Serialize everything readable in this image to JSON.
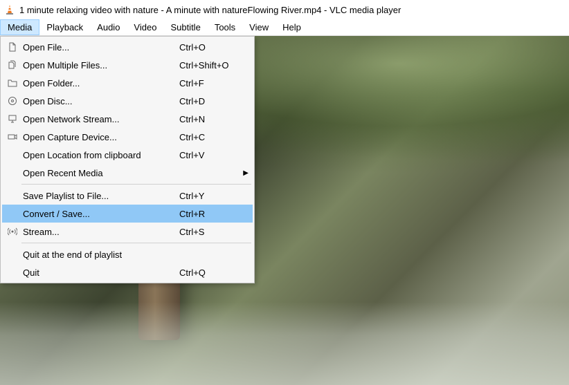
{
  "titlebar": {
    "title": "1 minute relaxing video with nature - A minute with natureFlowing River.mp4 - VLC media player"
  },
  "menubar": {
    "items": [
      {
        "label": "Media",
        "active": true
      },
      {
        "label": "Playback",
        "active": false
      },
      {
        "label": "Audio",
        "active": false
      },
      {
        "label": "Video",
        "active": false
      },
      {
        "label": "Subtitle",
        "active": false
      },
      {
        "label": "Tools",
        "active": false
      },
      {
        "label": "View",
        "active": false
      },
      {
        "label": "Help",
        "active": false
      }
    ]
  },
  "dropdown": {
    "items": [
      {
        "type": "item",
        "icon": "file-icon",
        "label": "Open File...",
        "shortcut": "Ctrl+O",
        "highlighted": false,
        "submenu": false,
        "name": "menu-open-file"
      },
      {
        "type": "item",
        "icon": "files-icon",
        "label": "Open Multiple Files...",
        "shortcut": "Ctrl+Shift+O",
        "highlighted": false,
        "submenu": false,
        "name": "menu-open-multiple-files"
      },
      {
        "type": "item",
        "icon": "folder-icon",
        "label": "Open Folder...",
        "shortcut": "Ctrl+F",
        "highlighted": false,
        "submenu": false,
        "name": "menu-open-folder"
      },
      {
        "type": "item",
        "icon": "disc-icon",
        "label": "Open Disc...",
        "shortcut": "Ctrl+D",
        "highlighted": false,
        "submenu": false,
        "name": "menu-open-disc"
      },
      {
        "type": "item",
        "icon": "network-icon",
        "label": "Open Network Stream...",
        "shortcut": "Ctrl+N",
        "highlighted": false,
        "submenu": false,
        "name": "menu-open-network-stream"
      },
      {
        "type": "item",
        "icon": "capture-icon",
        "label": "Open Capture Device...",
        "shortcut": "Ctrl+C",
        "highlighted": false,
        "submenu": false,
        "name": "menu-open-capture-device"
      },
      {
        "type": "item",
        "icon": "",
        "label": "Open Location from clipboard",
        "shortcut": "Ctrl+V",
        "highlighted": false,
        "submenu": false,
        "name": "menu-open-clipboard"
      },
      {
        "type": "item",
        "icon": "",
        "label": "Open Recent Media",
        "shortcut": "",
        "highlighted": false,
        "submenu": true,
        "name": "menu-open-recent"
      },
      {
        "type": "sep"
      },
      {
        "type": "item",
        "icon": "",
        "label": "Save Playlist to File...",
        "shortcut": "Ctrl+Y",
        "highlighted": false,
        "submenu": false,
        "name": "menu-save-playlist"
      },
      {
        "type": "item",
        "icon": "",
        "label": "Convert / Save...",
        "shortcut": "Ctrl+R",
        "highlighted": true,
        "submenu": false,
        "name": "menu-convert-save"
      },
      {
        "type": "item",
        "icon": "stream-icon",
        "label": "Stream...",
        "shortcut": "Ctrl+S",
        "highlighted": false,
        "submenu": false,
        "name": "menu-stream"
      },
      {
        "type": "sep"
      },
      {
        "type": "item",
        "icon": "",
        "label": "Quit at the end of playlist",
        "shortcut": "",
        "highlighted": false,
        "submenu": false,
        "name": "menu-quit-end"
      },
      {
        "type": "item",
        "icon": "",
        "label": "Quit",
        "shortcut": "Ctrl+Q",
        "highlighted": false,
        "submenu": false,
        "name": "menu-quit"
      }
    ]
  }
}
